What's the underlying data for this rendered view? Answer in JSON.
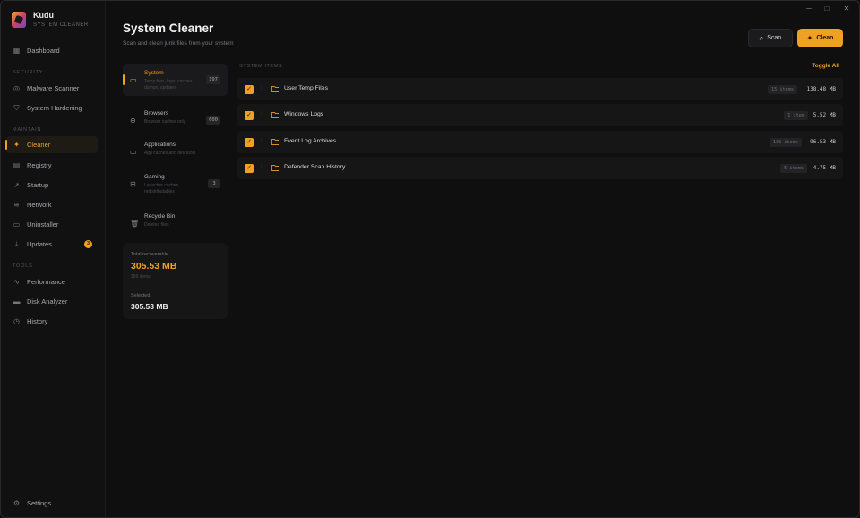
{
  "app": {
    "name": "Kudu",
    "subtitle": "SYSTEM CLEANER"
  },
  "window_controls": {
    "minimize": "─",
    "maximize": "□",
    "close": "✕"
  },
  "sidebar": {
    "dashboard": "Dashboard",
    "section_security": "SECURITY",
    "malware_scanner": "Malware Scanner",
    "system_hardening": "System Hardening",
    "section_maintain": "MAINTAIN",
    "cleaner": "Cleaner",
    "registry": "Registry",
    "startup": "Startup",
    "network": "Network",
    "uninstaller": "Uninstaller",
    "updates": "Updates",
    "updates_badge": "3",
    "section_tools": "TOOLS",
    "performance": "Performance",
    "disk_analyzer": "Disk Analyzer",
    "history": "History",
    "settings": "Settings"
  },
  "header": {
    "title": "System Cleaner",
    "subtitle": "Scan and clean junk files from your system",
    "scan_label": "Scan",
    "clean_label": "Clean"
  },
  "categories": [
    {
      "title": "System",
      "desc": "Temp files, logs, caches, dumps, updates",
      "count": "197",
      "active": true
    },
    {
      "title": "Browsers",
      "desc": "Browser caches only",
      "count": "600"
    },
    {
      "title": "Applications",
      "desc": "App caches and dev tools",
      "count": ""
    },
    {
      "title": "Gaming",
      "desc": "Launcher caches, redistributables",
      "count": "3"
    },
    {
      "title": "Recycle Bin",
      "desc": "Deleted files",
      "count": ""
    }
  ],
  "summary": {
    "total_label": "Total recoverable",
    "total_value": "305.53 MB",
    "total_items": "159 items",
    "selected_label": "Selected",
    "selected_value": "305.53 MB"
  },
  "items_header": "SYSTEM ITEMS",
  "toggle_all": "Toggle All",
  "items": [
    {
      "name": "User Temp Files",
      "count": "15 items",
      "size": "138.48 MB",
      "checked": true
    },
    {
      "name": "Windows Logs",
      "count": "1 item",
      "size": "5.52 MB",
      "checked": true
    },
    {
      "name": "Event Log Archives",
      "count": "136 items",
      "size": "96.53 MB",
      "checked": true
    },
    {
      "name": "Defender Scan History",
      "count": "5 items",
      "size": "4.75 MB",
      "checked": true
    }
  ],
  "colors": {
    "accent": "#f0a023",
    "background": "#0f0f10",
    "card": "#161617"
  }
}
